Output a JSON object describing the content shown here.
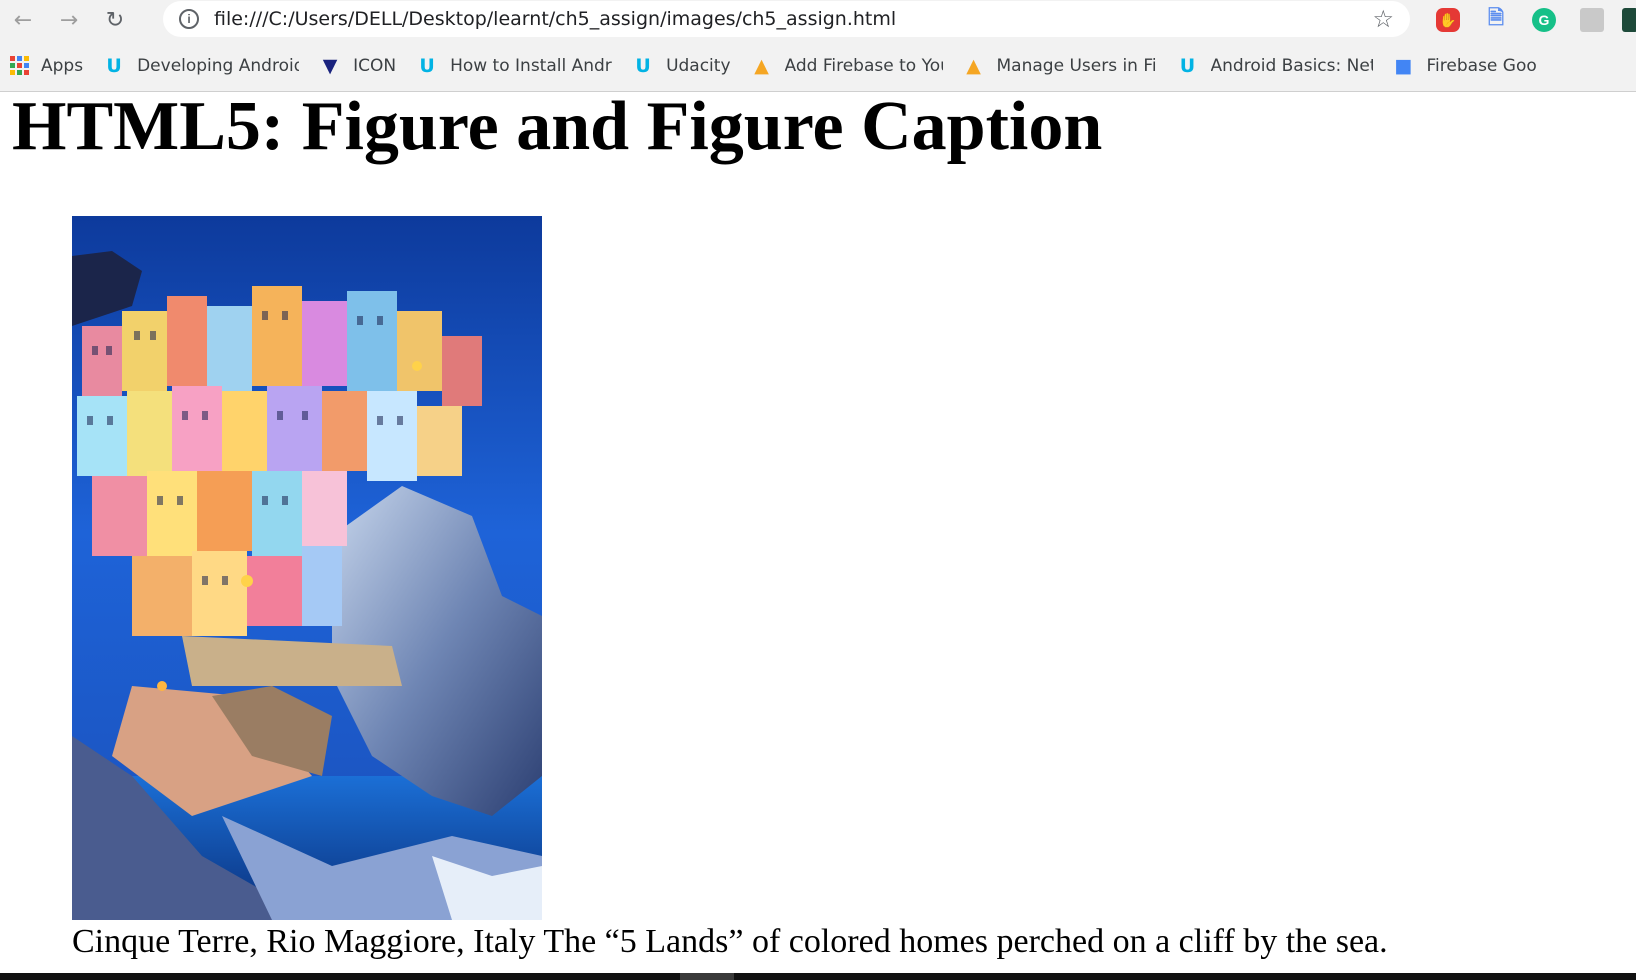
{
  "browser": {
    "url": "file:///C:/Users/DELL/Desktop/learnt/ch5_assign/images/ch5_assign.html",
    "back_icon": "arrow-left-icon",
    "forward_icon": "arrow-right-icon",
    "reload_icon": "reload-icon",
    "info_icon": "info-icon",
    "star_icon": "star-icon"
  },
  "bookmarks": [
    {
      "label": "Apps",
      "icon": "apps-grid-icon"
    },
    {
      "label": "Developing Android A",
      "icon": "udacity-icon"
    },
    {
      "label": "ICON",
      "icon": "icon-site-icon"
    },
    {
      "label": "How to Install Androi",
      "icon": "udacity-icon"
    },
    {
      "label": "Udacity",
      "icon": "udacity-icon"
    },
    {
      "label": "Add Firebase to Your",
      "icon": "firebase-icon"
    },
    {
      "label": "Manage Users in Fireb",
      "icon": "firebase-icon"
    },
    {
      "label": "Android Basics: Netw",
      "icon": "udacity-icon"
    },
    {
      "label": "Firebase Goo",
      "icon": "google-doc-icon"
    }
  ],
  "page": {
    "title": "HTML5: Figure and Figure Caption",
    "figure_caption": "Cinque Terre, Rio Maggiore, Italy The “5 Lands” of colored homes perched on a cliff by the sea."
  },
  "colors": {
    "chrome_bg": "#f2f2f2",
    "udacity_blue": "#02b3e4",
    "firebase_orange": "#f5a623",
    "adblock_red": "#e53935",
    "grammarly_green": "#16c088"
  }
}
